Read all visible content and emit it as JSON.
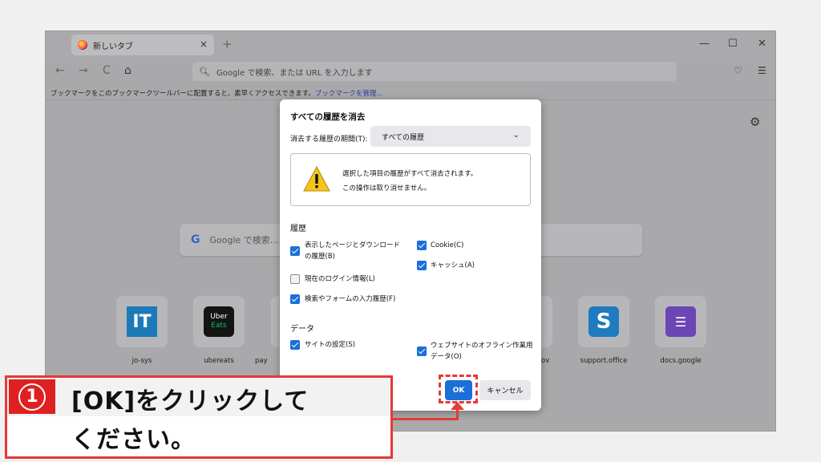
{
  "browser": {
    "tab_title": "新しいタブ",
    "tab_close": "×",
    "new_tab": "+",
    "window_controls": {
      "minimize": "—",
      "maximize": "☐",
      "close": "✕"
    },
    "nav": {
      "back": "←",
      "forward": "→",
      "reload": "C",
      "home": "⌂"
    },
    "url_placeholder": "Google で検索、または URL を入力します",
    "pocket_icon": "pocket-icon",
    "menu_icon": "☰",
    "bookmark_text": "ブックマークをこのブックマークツールバーに配置すると、素早くアクセスできます。",
    "bookmark_link": "ブックマークを管理...",
    "newtab_search_placeholder": "Google で検索...",
    "shortcuts": [
      {
        "label": "jo-sys",
        "icon": "IT"
      },
      {
        "label": "ubereats",
        "icon_top": "Uber",
        "icon_bottom": "Eats"
      },
      {
        "label": "pay",
        "partial": true
      },
      {
        "label": "ov",
        "partial": true
      },
      {
        "label": "support.office",
        "icon": "S"
      },
      {
        "label": "docs.google",
        "icon": "☰"
      }
    ]
  },
  "dialog": {
    "title": "すべての履歴を消去",
    "range_label": "消去する履歴の期間(T):",
    "range_value": "すべての履歴",
    "warning_line1": "選択した項目の履歴がすべて消去されます。",
    "warning_line2": "この操作は取り消せません。",
    "history_heading": "履歴",
    "data_heading": "データ",
    "checkboxes": {
      "browsing": {
        "label": "表示したページとダウンロードの履歴(B)",
        "checked": true
      },
      "cookie": {
        "label": "Cookie(C)",
        "checked": true
      },
      "cache": {
        "label": "キャッシュ(A)",
        "checked": true
      },
      "logins": {
        "label": "現在のログイン情報(L)",
        "checked": false
      },
      "forms": {
        "label": "検索やフォームの入力履歴(F)",
        "checked": true
      },
      "site_settings": {
        "label": "サイトの設定(S)",
        "checked": true
      },
      "offline": {
        "label": "ウェブサイトのオフライン作業用データ(O)",
        "checked": true
      }
    },
    "ok_label": "OK",
    "cancel_label": "キャンセル"
  },
  "annotation": {
    "step_number": "1",
    "line1": "[OK]をクリックして",
    "line2": "ください。",
    "color": "#e53935"
  }
}
